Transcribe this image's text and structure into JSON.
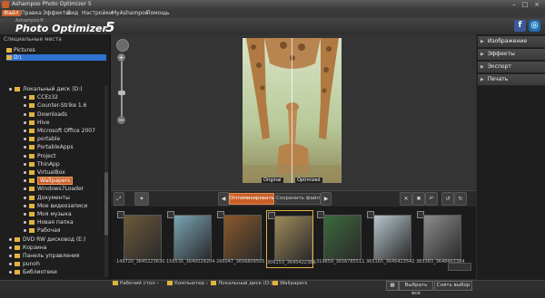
{
  "window": {
    "title": "Ashampoo Photo Optimizer 5"
  },
  "menu": [
    "Файл",
    "Правка",
    "Эффекты",
    "Вид",
    "Настройки",
    "MyAshampoo",
    "Помощь"
  ],
  "brand": {
    "maker": "Ashampoo®",
    "product": "Photo Optimizer",
    "version": "5"
  },
  "left": {
    "special_header": "Специальные места",
    "special_items": [
      "Pictures",
      "D:\\"
    ],
    "tree": [
      {
        "label": "Локальный диск (D:)",
        "indent": 1
      },
      {
        "label": "CCEz32",
        "indent": 3
      },
      {
        "label": "Counter-Strike 1.6",
        "indent": 3
      },
      {
        "label": "Downloads",
        "indent": 3
      },
      {
        "label": "Hive",
        "indent": 3
      },
      {
        "label": "Microsoft Office 2007",
        "indent": 3
      },
      {
        "label": "portable",
        "indent": 3
      },
      {
        "label": "PortableApps",
        "indent": 3
      },
      {
        "label": "Project",
        "indent": 3
      },
      {
        "label": "ThinApp",
        "indent": 3
      },
      {
        "label": "VirtualBox",
        "indent": 3
      },
      {
        "label": "Wallpapers",
        "indent": 3,
        "selected": true
      },
      {
        "label": "Windows7Loader",
        "indent": 3
      },
      {
        "label": "Документы",
        "indent": 3
      },
      {
        "label": "Мое видеозаписи",
        "indent": 3
      },
      {
        "label": "Моя музыка",
        "indent": 3
      },
      {
        "label": "Новая папка",
        "indent": 3
      },
      {
        "label": "Рабочая",
        "indent": 3
      },
      {
        "label": "DVD RW дисковод (E:)",
        "indent": 1
      },
      {
        "label": "Корзина",
        "indent": 1
      },
      {
        "label": "Панель управления",
        "indent": 1
      },
      {
        "label": "punoh",
        "indent": 1
      },
      {
        "label": "Библиотеки",
        "indent": 1
      }
    ]
  },
  "preview": {
    "original_label": "Original",
    "optimized_label": "Optimized"
  },
  "right": {
    "sections": [
      "Изображение",
      "Эффекты",
      "Экспорт",
      "Печать"
    ]
  },
  "toolbar": {
    "optimize": "Оптимизировать",
    "save": "Сохранить файл"
  },
  "thumbnails": [
    {
      "caption": "149720_3645223630",
      "color": "#6d5a3a"
    },
    {
      "caption": "156535_3640029204",
      "color": "#7aa4b6"
    },
    {
      "caption": "295047_3656809505",
      "color": "#8b5a2b"
    },
    {
      "caption": "306153_36454223892",
      "color": "#a08a5a",
      "selected": true
    },
    {
      "caption": "319859_3656785511",
      "color": "#3d6b3d"
    },
    {
      "caption": "365165_3645423542",
      "color": "#b7c6cd"
    },
    {
      "caption": "383383_3648463384",
      "color": "#8c8c8c"
    }
  ],
  "status": {
    "crumbs": [
      "Рабочий стол",
      "Компьютер",
      "Локальный диск (D:)",
      "Wallpapers"
    ],
    "select_all": "Выбрать все",
    "deselect": "Снять выбор"
  },
  "colors": {
    "accent": "#c9602a",
    "selection_blue": "#2f72d1"
  }
}
